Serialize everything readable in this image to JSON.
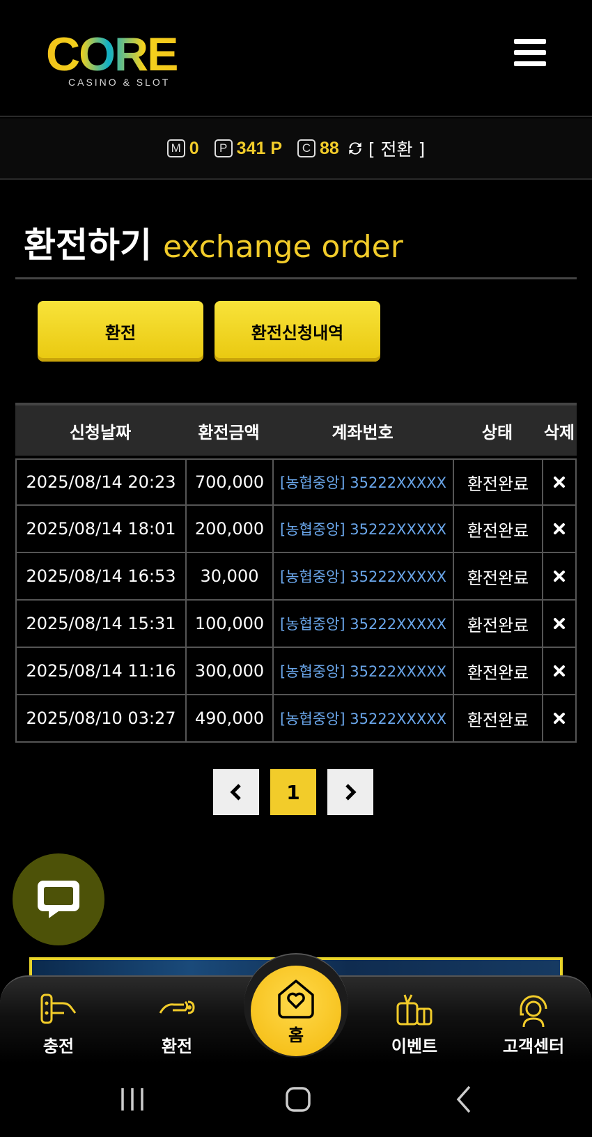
{
  "header": {
    "logo_word": "CORE",
    "logo_sub": "CASINO & SLOT",
    "menu_icon": "hamburger-menu-icon"
  },
  "points": {
    "money_label": "M",
    "money_value": "0",
    "point_label": "P",
    "point_value": "341 P",
    "comp_label": "C",
    "comp_value": "88",
    "refresh_icon": "refresh-icon",
    "convert_label": "[ 전환 ]"
  },
  "page": {
    "title_ko": "환전하기",
    "title_en": "exchange order"
  },
  "tabs": [
    {
      "label": "환전"
    },
    {
      "label": "환전신청내역"
    }
  ],
  "table": {
    "headers": [
      "신청날짜",
      "환전금액",
      "계좌번호",
      "상태",
      "삭제"
    ],
    "rows": [
      {
        "date": "2025/08/14 20:23",
        "amount": "700,000",
        "account": "[농협중앙] 35222XXXXX",
        "status": "환전완료"
      },
      {
        "date": "2025/08/14 18:01",
        "amount": "200,000",
        "account": "[농협중앙] 35222XXXXX",
        "status": "환전완료"
      },
      {
        "date": "2025/08/14 16:53",
        "amount": "30,000",
        "account": "[농협중앙] 35222XXXXX",
        "status": "환전완료"
      },
      {
        "date": "2025/08/14 15:31",
        "amount": "100,000",
        "account": "[농협중앙] 35222XXXXX",
        "status": "환전완료"
      },
      {
        "date": "2025/08/14 11:16",
        "amount": "300,000",
        "account": "[농협중앙] 35222XXXXX",
        "status": "환전완료"
      },
      {
        "date": "2025/08/10 03:27",
        "amount": "490,000",
        "account": "[농협중앙] 35222XXXXX",
        "status": "환전완료"
      }
    ]
  },
  "pagination": {
    "current": "1"
  },
  "bottom_nav": {
    "charge": "충전",
    "exchange": "환전",
    "home": "홈",
    "event": "이벤트",
    "support": "고객센터"
  },
  "colors": {
    "accent": "#f2cc2a",
    "account_link": "#6aa6ea",
    "chat_bg": "#4d5208"
  }
}
